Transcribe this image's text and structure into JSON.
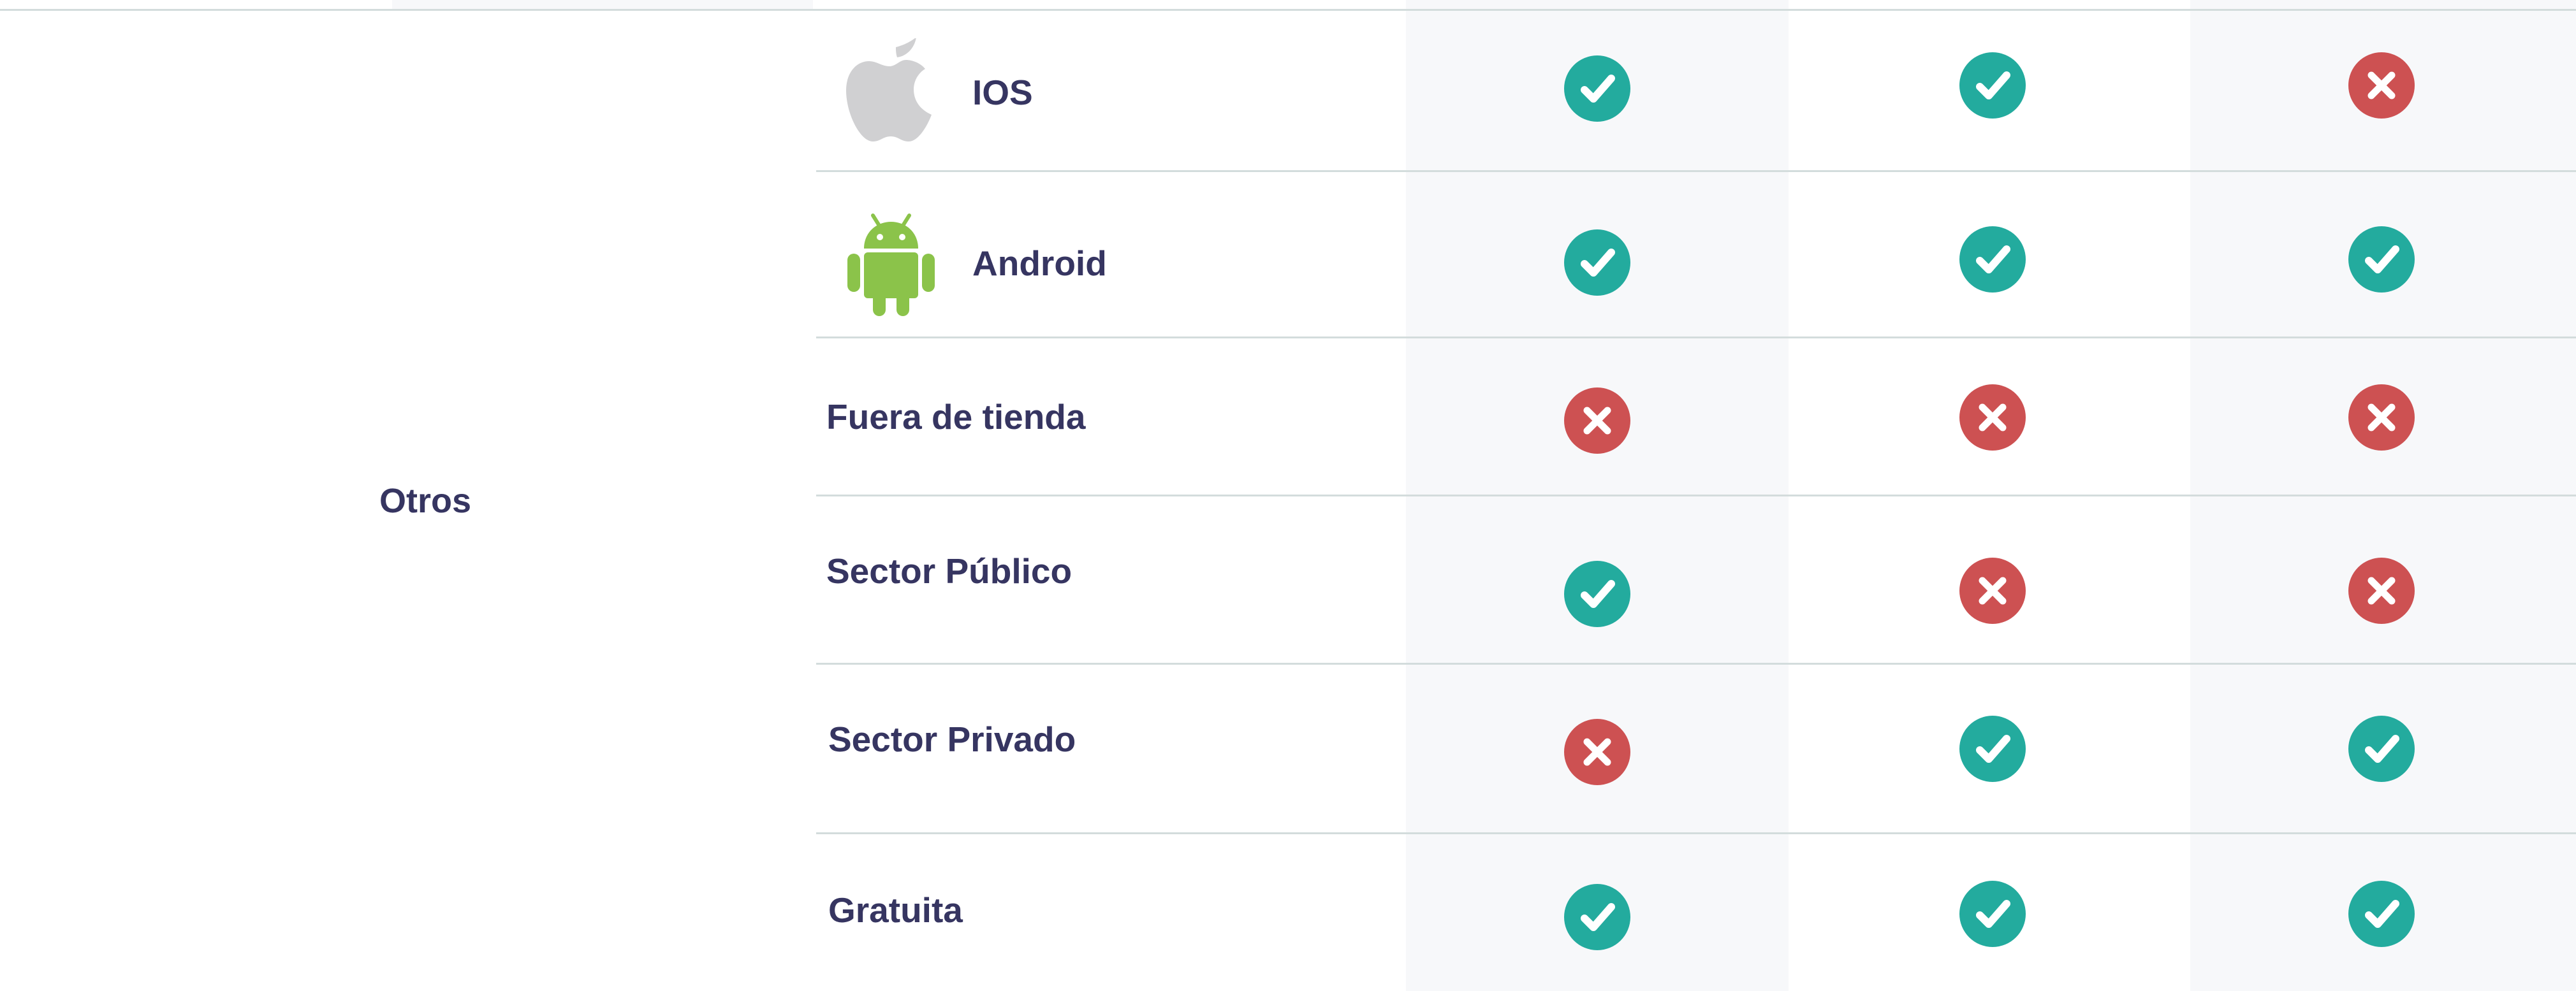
{
  "group": {
    "label": "Otros"
  },
  "colors": {
    "yes": "#23ab9e",
    "no": "#cd5152",
    "text": "#363561",
    "shade": "#f7f8fa",
    "divider": "#d3dcdc",
    "android": "#8bc34a",
    "apple": "#d0d0d2"
  },
  "rows": [
    {
      "label": "IOS",
      "icon": "apple-icon",
      "status": [
        "yes",
        "yes",
        "no"
      ]
    },
    {
      "label": "Android",
      "icon": "android-icon",
      "status": [
        "yes",
        "yes",
        "yes"
      ]
    },
    {
      "label": "Fuera de tienda",
      "status": [
        "no",
        "no",
        "no"
      ]
    },
    {
      "label": "Sector Público",
      "status": [
        "yes",
        "no",
        "no"
      ]
    },
    {
      "label": "Sector Privado",
      "status": [
        "no",
        "yes",
        "yes"
      ]
    },
    {
      "label": "Gratuita",
      "status": [
        "yes",
        "yes",
        "yes"
      ]
    }
  ]
}
